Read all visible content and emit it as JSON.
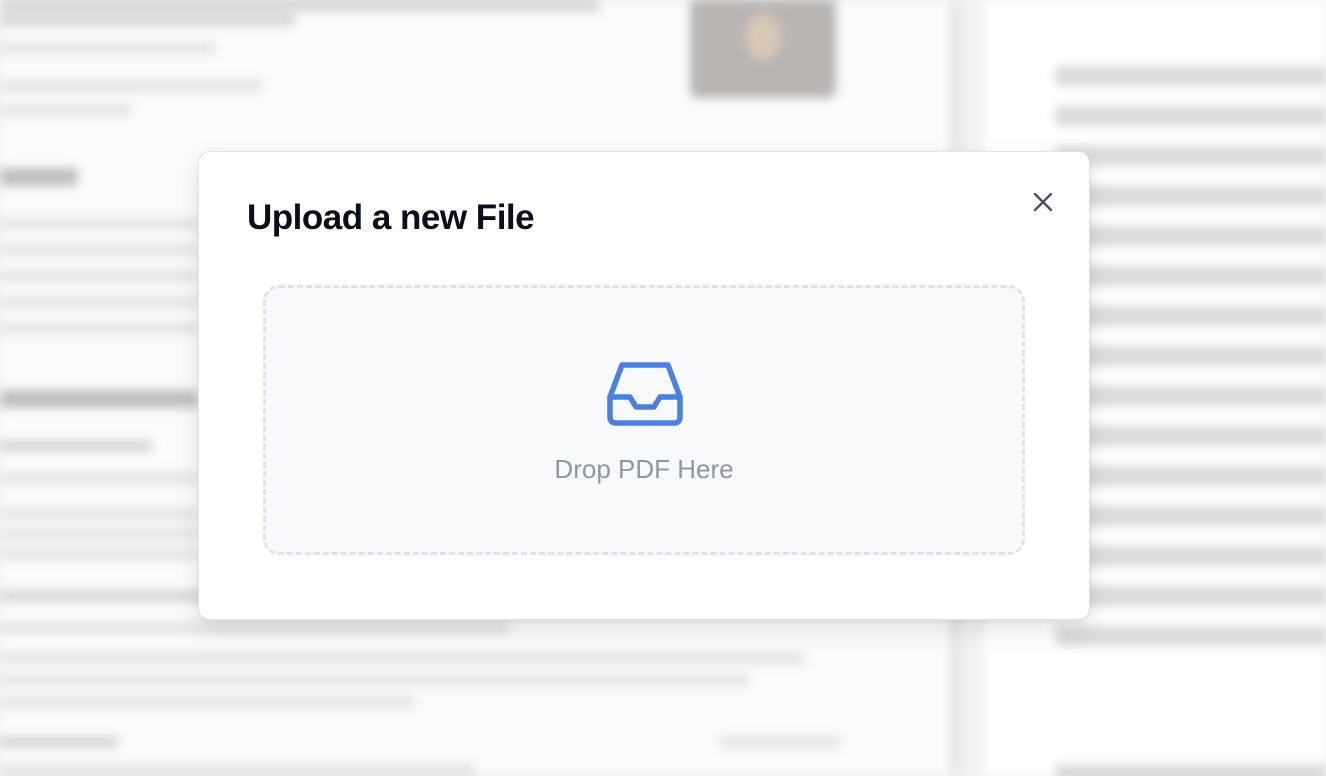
{
  "modal": {
    "title": "Upload a new File",
    "close_icon": "close-icon",
    "dropzone": {
      "label": "Drop PDF Here",
      "icon": "inbox-icon",
      "icon_color": "#4a7fe3"
    }
  },
  "colors": {
    "title": "#0b0f1a",
    "dropzone_border": "#dfe3ea",
    "dropzone_background": "#f8f9fb",
    "label": "#8f97a6",
    "close_icon": "#4b5160"
  }
}
